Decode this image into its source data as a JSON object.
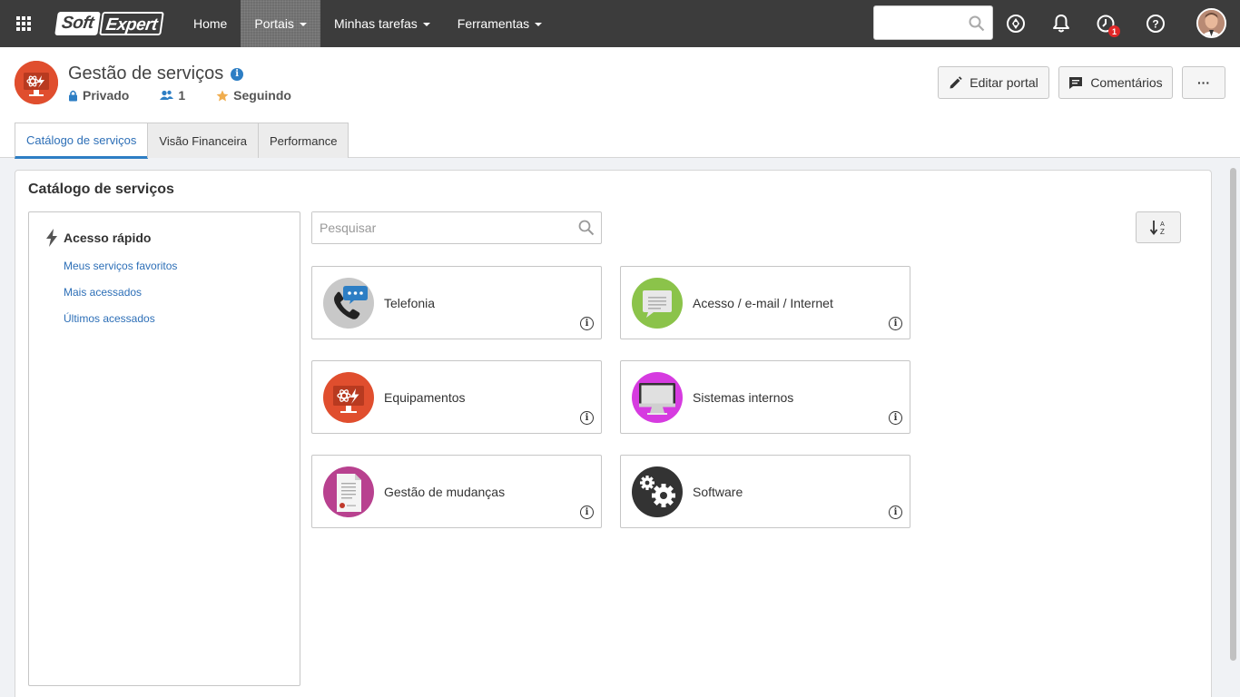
{
  "topbar": {
    "apps_icon": "apps-grid-icon",
    "logo_part1": "Soft",
    "logo_part2": "Expert",
    "nav": [
      {
        "label": "Home",
        "active": false,
        "dropdown": false
      },
      {
        "label": "Portais",
        "active": true,
        "dropdown": true
      },
      {
        "label": "Minhas tarefas",
        "active": false,
        "dropdown": true
      },
      {
        "label": "Ferramentas",
        "active": false,
        "dropdown": true
      }
    ],
    "search_value": "",
    "notifications_badge": "1"
  },
  "portal": {
    "title": "Gestão de serviços",
    "privacy": "Privado",
    "members": "1",
    "following": "Seguindo",
    "edit_label": "Editar portal",
    "comments_label": "Comentários",
    "more_label": "···"
  },
  "tabs": [
    {
      "label": "Catálogo de serviços",
      "active": true
    },
    {
      "label": "Visão Financeira",
      "active": false
    },
    {
      "label": "Performance",
      "active": false
    }
  ],
  "catalog": {
    "title": "Catálogo de serviços",
    "quick_access_title": "Acesso rápido",
    "quick_links": [
      "Meus serviços favoritos",
      "Mais acessados",
      "Últimos acessados"
    ],
    "search_placeholder": "Pesquisar",
    "services": [
      {
        "label": "Telefonia",
        "icon": "telephone-chat-icon",
        "color": "#c8c8c8"
      },
      {
        "label": "Acesso / e-mail / Internet",
        "icon": "message-bubble-icon",
        "color": "#8bc34a"
      },
      {
        "label": "Equipamentos",
        "icon": "monitor-atom-icon",
        "color": "#e04e2e"
      },
      {
        "label": "Sistemas internos",
        "icon": "computer-icon",
        "color": "#d63be0"
      },
      {
        "label": "Gestão de mudanças",
        "icon": "document-certificate-icon",
        "color": "#b8418f"
      },
      {
        "label": "Software",
        "icon": "gears-icon",
        "color": "#333333"
      }
    ]
  },
  "colors": {
    "topbar": "#3c3c3c",
    "accent": "#2d7ec4",
    "link": "#2d6fb7"
  }
}
